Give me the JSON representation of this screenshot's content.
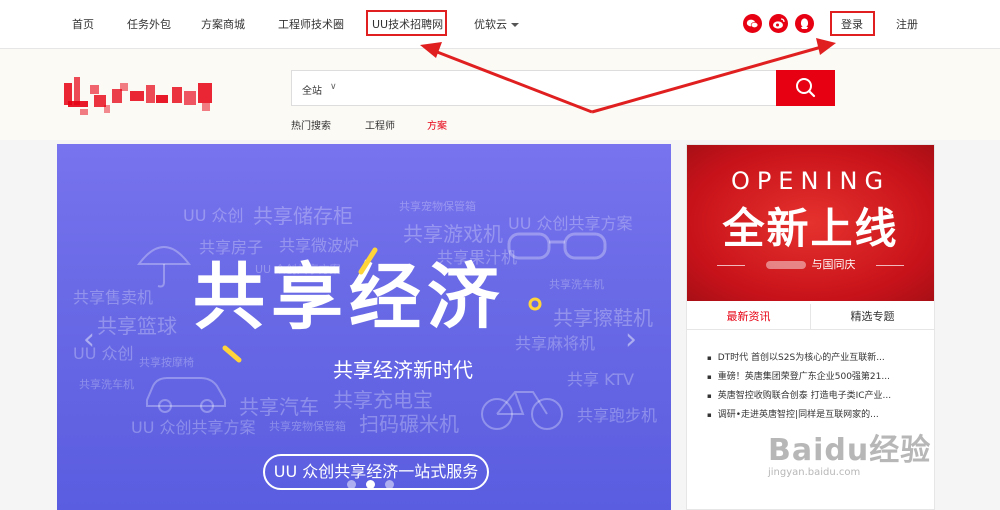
{
  "nav": {
    "items": [
      "首页",
      "任务外包",
      "方案商城",
      "工程师技术圈",
      "UU技术招聘网",
      "优软云"
    ],
    "login": "登录",
    "register": "注册"
  },
  "search": {
    "scope": "全站",
    "scope_caret": "∨",
    "hot": [
      "热门搜索",
      "工程师",
      "方案"
    ]
  },
  "banner": {
    "words": [
      "UU 众创",
      "共享储存柜",
      "共享宠物保管箱",
      "UU 众创共享方案",
      "共享房子",
      "共享微波炉",
      "共享游戏机",
      "UU 众创共享方案",
      "共享果汁机",
      "共享售卖机",
      "共享洗车机",
      "共享篮球",
      "共享擦鞋机",
      "UU 众创",
      "共享按摩椅",
      "共享麻将机",
      "共享洗车机",
      "共享 KTV",
      "共享汽车",
      "共享充电宝",
      "UU 众创共享方案",
      "共享宠物保管箱",
      "扫码碾米机",
      "共享跑步机"
    ],
    "title": "共享经济",
    "subtitle": "共享经济新时代",
    "cta": "UU 众创共享经济一站式服务"
  },
  "promo": {
    "en": "OPENING",
    "cn": "全新上线",
    "tagline": "与国同庆"
  },
  "tabs": [
    "最新资讯",
    "精选专题"
  ],
  "news": [
    "DT时代 首创以S2S为核心的产业互联新...",
    "重磅！英唐集团荣登广东企业500强第21...",
    "英唐智控收购联合创泰 打造电子类IC产业...",
    "调研•走进英唐智控|同样是互联网家的..."
  ],
  "watermark": {
    "main": "Baidu经验",
    "url": "jingyan.baidu.com"
  },
  "colors": {
    "accent": "#e60012",
    "annotation": "#e02020",
    "banner": "#6a6ae6"
  },
  "icons": [
    "wechat-icon",
    "weibo-icon",
    "qq-icon",
    "search-icon",
    "umbrella-icon",
    "car-icon",
    "bicycle-icon",
    "glasses-icon"
  ]
}
